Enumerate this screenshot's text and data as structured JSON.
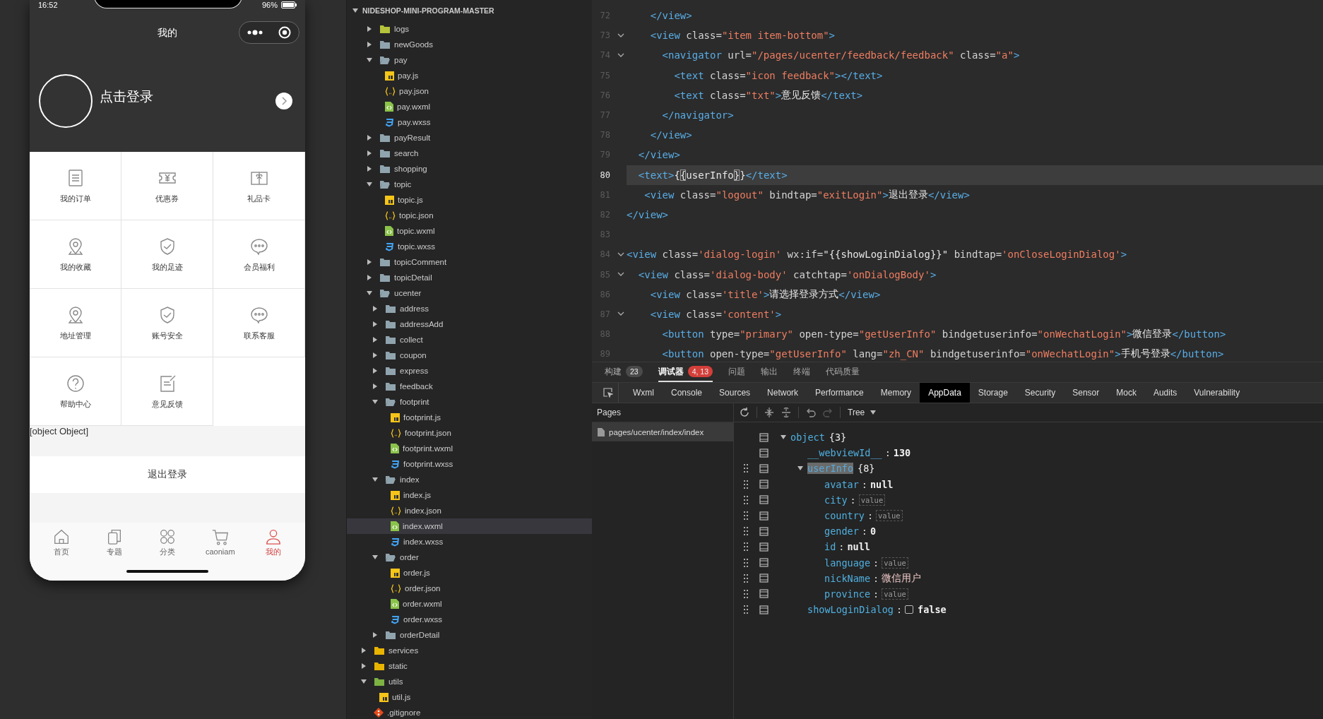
{
  "phone": {
    "status": {
      "time": "16:52",
      "battery": "96%"
    },
    "nav_title": "我的",
    "login_text": "点击登录",
    "grid": [
      {
        "kind": "orders",
        "label": "我的订单"
      },
      {
        "kind": "coupon",
        "label": "优惠券"
      },
      {
        "kind": "giftcard",
        "label": "礼品卡"
      },
      {
        "kind": "pin",
        "label": "我的收藏"
      },
      {
        "kind": "shield",
        "label": "我的足迹"
      },
      {
        "kind": "chat",
        "label": "会员福利"
      },
      {
        "kind": "pin",
        "label": "地址管理"
      },
      {
        "kind": "shield",
        "label": "账号安全"
      },
      {
        "kind": "chat",
        "label": "联系客服"
      },
      {
        "kind": "help",
        "label": "帮助中心"
      },
      {
        "kind": "feedback",
        "label": "意见反馈"
      }
    ],
    "user_info_text": "[object Object]",
    "logout": "退出登录",
    "tabbar": [
      {
        "kind": "home",
        "label": "首页",
        "selected": false
      },
      {
        "kind": "topic",
        "label": "专题",
        "selected": false
      },
      {
        "kind": "category",
        "label": "分类",
        "selected": false
      },
      {
        "kind": "cart",
        "label": "caoniam",
        "selected": false
      },
      {
        "kind": "user",
        "label": "我的",
        "selected": true
      }
    ]
  },
  "explorer": {
    "root": "NIDESHOP-MINI-PROGRAM-MASTER",
    "nested_items": [
      {
        "kind": "libfolder",
        "color": "#b5c43a",
        "name": "logs",
        "expanded": false,
        "selected": false
      },
      {
        "kind": "folder",
        "name": "newGoods",
        "expanded": false,
        "selected": false
      },
      {
        "kind": "folder",
        "name": "pay",
        "expanded": true,
        "selected": false,
        "children": [
          {
            "kind": "js",
            "name": "pay.js",
            "selected": false
          },
          {
            "kind": "json",
            "name": "pay.json",
            "selected": false
          },
          {
            "kind": "wxml",
            "name": "pay.wxml",
            "selected": false
          },
          {
            "kind": "wxss",
            "name": "pay.wxss",
            "selected": false
          }
        ]
      },
      {
        "kind": "folder",
        "name": "payResult",
        "expanded": false,
        "selected": false
      },
      {
        "kind": "folder",
        "name": "search",
        "expanded": false,
        "selected": false
      },
      {
        "kind": "folder",
        "name": "shopping",
        "expanded": false,
        "selected": false
      },
      {
        "kind": "folder",
        "name": "topic",
        "expanded": true,
        "selected": false,
        "children": [
          {
            "kind": "js",
            "name": "topic.js",
            "selected": false
          },
          {
            "kind": "json",
            "name": "topic.json",
            "selected": false
          },
          {
            "kind": "wxml",
            "name": "topic.wxml",
            "selected": false
          },
          {
            "kind": "wxss",
            "name": "topic.wxss",
            "selected": false
          }
        ]
      },
      {
        "kind": "folder",
        "name": "topicComment",
        "expanded": false,
        "selected": false
      },
      {
        "kind": "folder",
        "name": "topicDetail",
        "expanded": false,
        "selected": false
      },
      {
        "kind": "folder",
        "name": "ucenter",
        "expanded": true,
        "selected": false,
        "children": [
          {
            "kind": "folder",
            "name": "address",
            "expanded": false,
            "selected": false
          },
          {
            "kind": "folder",
            "name": "addressAdd",
            "expanded": false,
            "selected": false
          },
          {
            "kind": "folder",
            "name": "collect",
            "expanded": false,
            "selected": false
          },
          {
            "kind": "folder",
            "name": "coupon",
            "expanded": false,
            "selected": false
          },
          {
            "kind": "folder",
            "name": "express",
            "expanded": false,
            "selected": false
          },
          {
            "kind": "folder",
            "name": "feedback",
            "expanded": false,
            "selected": false
          },
          {
            "kind": "folder",
            "name": "footprint",
            "expanded": true,
            "selected": false,
            "children": [
              {
                "kind": "js",
                "name": "footprint.js",
                "selected": false
              },
              {
                "kind": "json",
                "name": "footprint.json",
                "selected": false
              },
              {
                "kind": "wxml",
                "name": "footprint.wxml",
                "selected": false
              },
              {
                "kind": "wxss",
                "name": "footprint.wxss",
                "selected": false
              }
            ]
          },
          {
            "kind": "folder",
            "name": "index",
            "expanded": true,
            "selected": false,
            "children": [
              {
                "kind": "js",
                "name": "index.js",
                "selected": false
              },
              {
                "kind": "json",
                "name": "index.json",
                "selected": false
              },
              {
                "kind": "wxml",
                "name": "index.wxml",
                "selected": true
              },
              {
                "kind": "wxss",
                "name": "index.wxss",
                "selected": false
              }
            ]
          },
          {
            "kind": "folder",
            "name": "order",
            "expanded": true,
            "selected": false,
            "children": [
              {
                "kind": "js",
                "name": "order.js",
                "selected": false
              },
              {
                "kind": "json",
                "name": "order.json",
                "selected": false
              },
              {
                "kind": "wxml",
                "name": "order.wxml",
                "selected": false
              },
              {
                "kind": "wxss",
                "name": "order.wxss",
                "selected": false
              }
            ]
          },
          {
            "kind": "folder",
            "name": "orderDetail",
            "expanded": false,
            "selected": false
          }
        ]
      }
    ],
    "items": [
      {
        "kind": "libfolder",
        "color": "#e8b400",
        "name": "services",
        "expanded": false,
        "selected": false
      },
      {
        "kind": "libfolder",
        "color": "#e8b400",
        "name": "static",
        "expanded": false,
        "selected": false
      },
      {
        "kind": "libfolder",
        "color": "#7cb342",
        "name": "utils",
        "expanded": true,
        "selected": false,
        "children": [
          {
            "kind": "js",
            "name": "util.js",
            "selected": false
          }
        ]
      },
      {
        "kind": "git",
        "name": ".gitignore",
        "selected": false
      }
    ]
  },
  "editor": {
    "lines": [
      {
        "number": "72",
        "foldable": false,
        "current": false,
        "tokens": [
          {
            "kind": "tag",
            "text": "    </view>"
          }
        ]
      },
      {
        "number": "73",
        "foldable": true,
        "current": false,
        "tokens": [
          {
            "kind": "tag",
            "text": "    <view"
          },
          {
            "kind": "attr",
            "text": " class="
          },
          {
            "kind": "str",
            "text": "\"item item-bottom\""
          },
          {
            "kind": "tag",
            "text": ">"
          }
        ]
      },
      {
        "number": "74",
        "foldable": true,
        "current": false,
        "tokens": [
          {
            "kind": "tag",
            "text": "      <navigator"
          },
          {
            "kind": "attr",
            "text": " url="
          },
          {
            "kind": "str",
            "text": "\"/pages/ucenter/feedback/feedback\""
          },
          {
            "kind": "attr",
            "text": " class="
          },
          {
            "kind": "str",
            "text": "\"a\""
          },
          {
            "kind": "tag",
            "text": ">"
          }
        ]
      },
      {
        "number": "75",
        "foldable": false,
        "current": false,
        "tokens": [
          {
            "kind": "tag",
            "text": "        <text"
          },
          {
            "kind": "attr",
            "text": " class="
          },
          {
            "kind": "str",
            "text": "\"icon feedback\""
          },
          {
            "kind": "tag",
            "text": "></text>"
          }
        ]
      },
      {
        "number": "76",
        "foldable": false,
        "current": false,
        "tokens": [
          {
            "kind": "tag",
            "text": "        <text"
          },
          {
            "kind": "attr",
            "text": " class="
          },
          {
            "kind": "str",
            "text": "\"txt\""
          },
          {
            "kind": "tag",
            "text": ">"
          },
          {
            "kind": "text",
            "text": "意见反馈"
          },
          {
            "kind": "tag",
            "text": "</text>"
          }
        ]
      },
      {
        "number": "77",
        "foldable": false,
        "current": false,
        "tokens": [
          {
            "kind": "tag",
            "text": "      </navigator>"
          }
        ]
      },
      {
        "number": "78",
        "foldable": false,
        "current": false,
        "tokens": [
          {
            "kind": "tag",
            "text": "    </view>"
          }
        ]
      },
      {
        "number": "79",
        "foldable": false,
        "current": false,
        "tokens": [
          {
            "kind": "tag",
            "text": "  </view>"
          }
        ]
      },
      {
        "number": "80",
        "foldable": false,
        "current": true,
        "tokens": [
          {
            "kind": "tag",
            "text": "  <text>"
          },
          {
            "kind": "text",
            "text": "{"
          },
          {
            "kind": "match",
            "text": "{"
          },
          {
            "kind": "text",
            "text": "userInfo"
          },
          {
            "kind": "match",
            "text": "}"
          },
          {
            "kind": "text",
            "text": "}"
          },
          {
            "kind": "tag",
            "text": "</text>"
          }
        ]
      },
      {
        "number": "81",
        "foldable": false,
        "current": false,
        "tokens": [
          {
            "kind": "tag",
            "text": "   <view"
          },
          {
            "kind": "attr",
            "text": " class="
          },
          {
            "kind": "str",
            "text": "\"logout\""
          },
          {
            "kind": "attr",
            "text": " bindtap="
          },
          {
            "kind": "str",
            "text": "\"exitLogin\""
          },
          {
            "kind": "tag",
            "text": ">"
          },
          {
            "kind": "text",
            "text": "退出登录"
          },
          {
            "kind": "tag",
            "text": "</view>"
          }
        ]
      },
      {
        "number": "82",
        "foldable": false,
        "current": false,
        "tokens": [
          {
            "kind": "tag",
            "text": "</view>"
          }
        ]
      },
      {
        "number": "83",
        "foldable": false,
        "current": false
      },
      {
        "number": "84",
        "foldable": true,
        "current": false,
        "tokens": [
          {
            "kind": "tag",
            "text": "<view"
          },
          {
            "kind": "attr",
            "text": " class="
          },
          {
            "kind": "str",
            "text": "'dialog-login'"
          },
          {
            "kind": "attr",
            "text": " wx:if="
          },
          {
            "kind": "text",
            "text": "\"{{showLoginDialog}}\""
          },
          {
            "kind": "attr",
            "text": " bindtap="
          },
          {
            "kind": "str",
            "text": "'onCloseLoginDialog'"
          },
          {
            "kind": "tag",
            "text": ">"
          }
        ]
      },
      {
        "number": "85",
        "foldable": true,
        "current": false,
        "tokens": [
          {
            "kind": "tag",
            "text": "  <view"
          },
          {
            "kind": "attr",
            "text": " class="
          },
          {
            "kind": "str",
            "text": "'dialog-body'"
          },
          {
            "kind": "attr",
            "text": " catchtap="
          },
          {
            "kind": "str",
            "text": "'onDialogBody'"
          },
          {
            "kind": "tag",
            "text": ">"
          }
        ]
      },
      {
        "number": "86",
        "foldable": false,
        "current": false,
        "tokens": [
          {
            "kind": "tag",
            "text": "    <view"
          },
          {
            "kind": "attr",
            "text": " class="
          },
          {
            "kind": "str",
            "text": "'title'"
          },
          {
            "kind": "tag",
            "text": ">"
          },
          {
            "kind": "text",
            "text": "请选择登录方式"
          },
          {
            "kind": "tag",
            "text": "</view>"
          }
        ]
      },
      {
        "number": "87",
        "foldable": true,
        "current": false,
        "tokens": [
          {
            "kind": "tag",
            "text": "    <view"
          },
          {
            "kind": "attr",
            "text": " class="
          },
          {
            "kind": "str",
            "text": "'content'"
          },
          {
            "kind": "tag",
            "text": ">"
          }
        ]
      },
      {
        "number": "88",
        "foldable": false,
        "current": false,
        "tokens": [
          {
            "kind": "tag",
            "text": "      <button"
          },
          {
            "kind": "attr",
            "text": " type="
          },
          {
            "kind": "str",
            "text": "\"primary\""
          },
          {
            "kind": "attr",
            "text": " open-type="
          },
          {
            "kind": "str",
            "text": "\"getUserInfo\""
          },
          {
            "kind": "attr",
            "text": " bindgetuserinfo="
          },
          {
            "kind": "str",
            "text": "\"onWechatLogin\""
          },
          {
            "kind": "tag",
            "text": ">"
          },
          {
            "kind": "text",
            "text": "微信登录"
          },
          {
            "kind": "tag",
            "text": "</button>"
          }
        ]
      },
      {
        "number": "89",
        "foldable": false,
        "current": false,
        "tokens": [
          {
            "kind": "tag",
            "text": "      <button"
          },
          {
            "kind": "attr",
            "text": " open-type="
          },
          {
            "kind": "str",
            "text": "\"getUserInfo\""
          },
          {
            "kind": "attr",
            "text": " lang="
          },
          {
            "kind": "str",
            "text": "\"zh_CN\""
          },
          {
            "kind": "attr",
            "text": " bindgetuserinfo="
          },
          {
            "kind": "str",
            "text": "\"onWechatLogin\""
          },
          {
            "kind": "tag",
            "text": ">"
          },
          {
            "kind": "text",
            "text": "手机号登录"
          },
          {
            "kind": "tag",
            "text": "</button>"
          }
        ]
      }
    ]
  },
  "panel_tabs": [
    {
      "label": "构建",
      "badge": {
        "text": "23",
        "color": "#4a4a4a"
      },
      "selected": false
    },
    {
      "label": "调试器",
      "badge": {
        "text": "4, 13",
        "color": "#d43f3a"
      },
      "selected": true
    },
    {
      "label": "问题",
      "selected": false
    },
    {
      "label": "输出",
      "selected": false
    },
    {
      "label": "终端",
      "selected": false
    },
    {
      "label": "代码质量",
      "selected": false
    }
  ],
  "devtools_tabs": [
    {
      "label": "Wxml",
      "selected": false
    },
    {
      "label": "Console",
      "selected": false
    },
    {
      "label": "Sources",
      "selected": false
    },
    {
      "label": "Network",
      "selected": false
    },
    {
      "label": "Performance",
      "selected": false
    },
    {
      "label": "Memory",
      "selected": false
    },
    {
      "label": "AppData",
      "selected": true
    },
    {
      "label": "Storage",
      "selected": false
    },
    {
      "label": "Security",
      "selected": false
    },
    {
      "label": "Sensor",
      "selected": false
    },
    {
      "label": "Mock",
      "selected": false
    },
    {
      "label": "Audits",
      "selected": false
    },
    {
      "label": "Vulnerability",
      "selected": false
    }
  ],
  "appdata": {
    "pages_header": "Pages",
    "pages": [
      {
        "label": "pages/ucenter/index/index",
        "selected": true
      }
    ],
    "view_mode": "Tree",
    "separator": ":",
    "tree": [
      {
        "key": "object",
        "summary": "{3}",
        "expanded": true,
        "handle": false,
        "selected": false,
        "children": [
          {
            "key": "__webviewId__",
            "kind": "number",
            "value": "130",
            "handle": false,
            "selected": false
          },
          {
            "key": "userInfo",
            "summary": "{8}",
            "expanded": true,
            "handle": true,
            "selected": true,
            "children": [
              {
                "key": "avatar",
                "kind": "null",
                "value": "null",
                "handle": true,
                "selected": false
              },
              {
                "key": "city",
                "kind": "placeholder",
                "value": "value",
                "handle": true,
                "selected": false
              },
              {
                "key": "country",
                "kind": "placeholder",
                "value": "value",
                "handle": true,
                "selected": false
              },
              {
                "key": "gender",
                "kind": "number",
                "value": "0",
                "handle": true,
                "selected": false
              },
              {
                "key": "id",
                "kind": "null",
                "value": "null",
                "handle": true,
                "selected": false
              },
              {
                "key": "language",
                "kind": "placeholder",
                "value": "value",
                "handle": true,
                "selected": false
              },
              {
                "key": "nickName",
                "kind": "string",
                "value": "微信用户",
                "handle": true,
                "selected": false
              },
              {
                "key": "province",
                "kind": "placeholder",
                "value": "value",
                "handle": true,
                "selected": false
              }
            ]
          },
          {
            "key": "showLoginDialog",
            "kind": "bool",
            "value": "false",
            "checked": false,
            "handle": true,
            "selected": false
          }
        ]
      }
    ]
  }
}
